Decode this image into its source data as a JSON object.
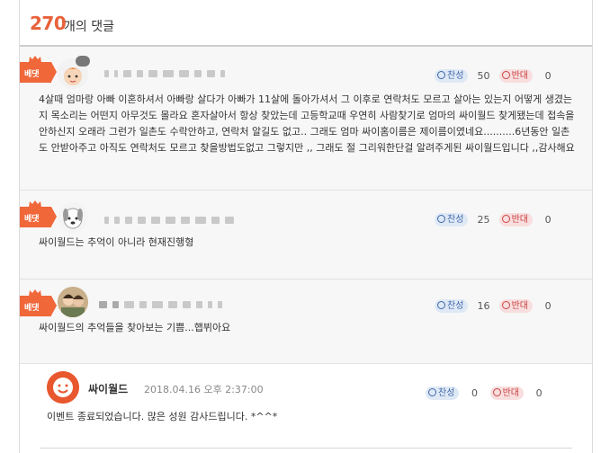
{
  "header": {
    "count": "270",
    "count_label": "개의 댓글"
  },
  "badge_label": "베댓",
  "vote_labels": {
    "up": "찬성",
    "down": "반대"
  },
  "comments": [
    {
      "up": "50",
      "down": "0",
      "text": "4살때 엄마랑 아빠 이혼하셔서 아빠랑 살다가 아빠가 11살에 돌아가셔서 그 이후로 연락처도 모르고 살아는 있는지 어떻게 생겼는지 목소리는 어떤지 아무것도 몰라요 혼자살아서 항상 찾았는데 고등학교때 우연히 사람찾기로 엄마의 싸이월드 찾게됐는데 접속을 안하신지 오래라 그런가 일촌도 수락안하고, 연락처 알길도 없고.. 그래도 엄마 싸이홈이름은 제이름이였네요..........6년동안 일촌도 안받아주고 아직도 연락처도 모르고 찾을방법도없고 그렇지만 ,, 그래도 절 그리워한단걸 알려주게된 싸이월드입니다 ,,감사해요"
    },
    {
      "up": "25",
      "down": "0",
      "text": "싸이월드는 추억이 아니라 현재진행형"
    },
    {
      "up": "16",
      "down": "0",
      "text": "싸이월드의 추억들을 찾아보는 기쁨...햅뷔아요"
    }
  ],
  "reply": {
    "name": "싸이월드",
    "date": "2018.04.16 오후 2:37:00",
    "up": "0",
    "down": "0",
    "text": "이벤트 종료되었습니다. 많은 성원 감사드립니다. *^^*"
  },
  "colors": {
    "accent": "#e8613a",
    "badge": "#f0673a",
    "up": "#3f67a8",
    "down": "#cc4444"
  }
}
